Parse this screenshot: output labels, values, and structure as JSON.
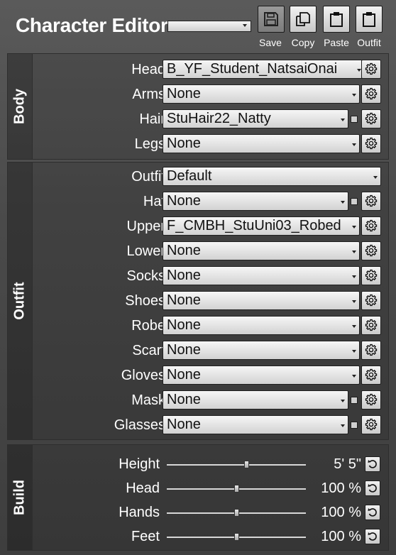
{
  "header": {
    "title": "Character Editor",
    "preset_value": "",
    "buttons": [
      {
        "id": "save",
        "label": "Save",
        "icon": "floppy-disk-icon",
        "disabled": true
      },
      {
        "id": "copy",
        "label": "Copy",
        "icon": "copy-icon",
        "disabled": false
      },
      {
        "id": "paste",
        "label": "Paste",
        "icon": "clipboard-icon",
        "disabled": false
      },
      {
        "id": "outfit",
        "label": "Outfit",
        "icon": "clipboard-icon",
        "disabled": false
      }
    ]
  },
  "body": {
    "label": "Body",
    "rows": [
      {
        "label": "Head",
        "value": "B_YF_Student_NatsaiOnai",
        "toggle": false
      },
      {
        "label": "Arms",
        "value": "None",
        "toggle": false
      },
      {
        "label": "Hair",
        "value": "StuHair22_Natty",
        "toggle": true
      },
      {
        "label": "Legs",
        "value": "None",
        "toggle": false
      }
    ]
  },
  "outfit": {
    "label": "Outfit",
    "outfit_row": {
      "label": "Outfit",
      "value": "Default"
    },
    "rows": [
      {
        "label": "Hat",
        "value": "None",
        "toggle": true
      },
      {
        "label": "Upper",
        "value": "F_CMBH_StuUni03_Robed",
        "toggle": false
      },
      {
        "label": "Lower",
        "value": "None",
        "toggle": false
      },
      {
        "label": "Socks",
        "value": "None",
        "toggle": false
      },
      {
        "label": "Shoes",
        "value": "None",
        "toggle": false
      },
      {
        "label": "Robe",
        "value": "None",
        "toggle": false
      },
      {
        "label": "Scarf",
        "value": "None",
        "toggle": false
      },
      {
        "label": "Gloves",
        "value": "None",
        "toggle": false
      },
      {
        "label": "Mask",
        "value": "None",
        "toggle": true
      },
      {
        "label": "Glasses",
        "value": "None",
        "toggle": true
      }
    ]
  },
  "build": {
    "label": "Build",
    "rows": [
      {
        "label": "Height",
        "value": "5' 5\"",
        "position": 0.57
      },
      {
        "label": "Head",
        "value": "100 %",
        "position": 0.5
      },
      {
        "label": "Hands",
        "value": "100 %",
        "position": 0.5
      },
      {
        "label": "Feet",
        "value": "100 %",
        "position": 0.5
      }
    ]
  }
}
